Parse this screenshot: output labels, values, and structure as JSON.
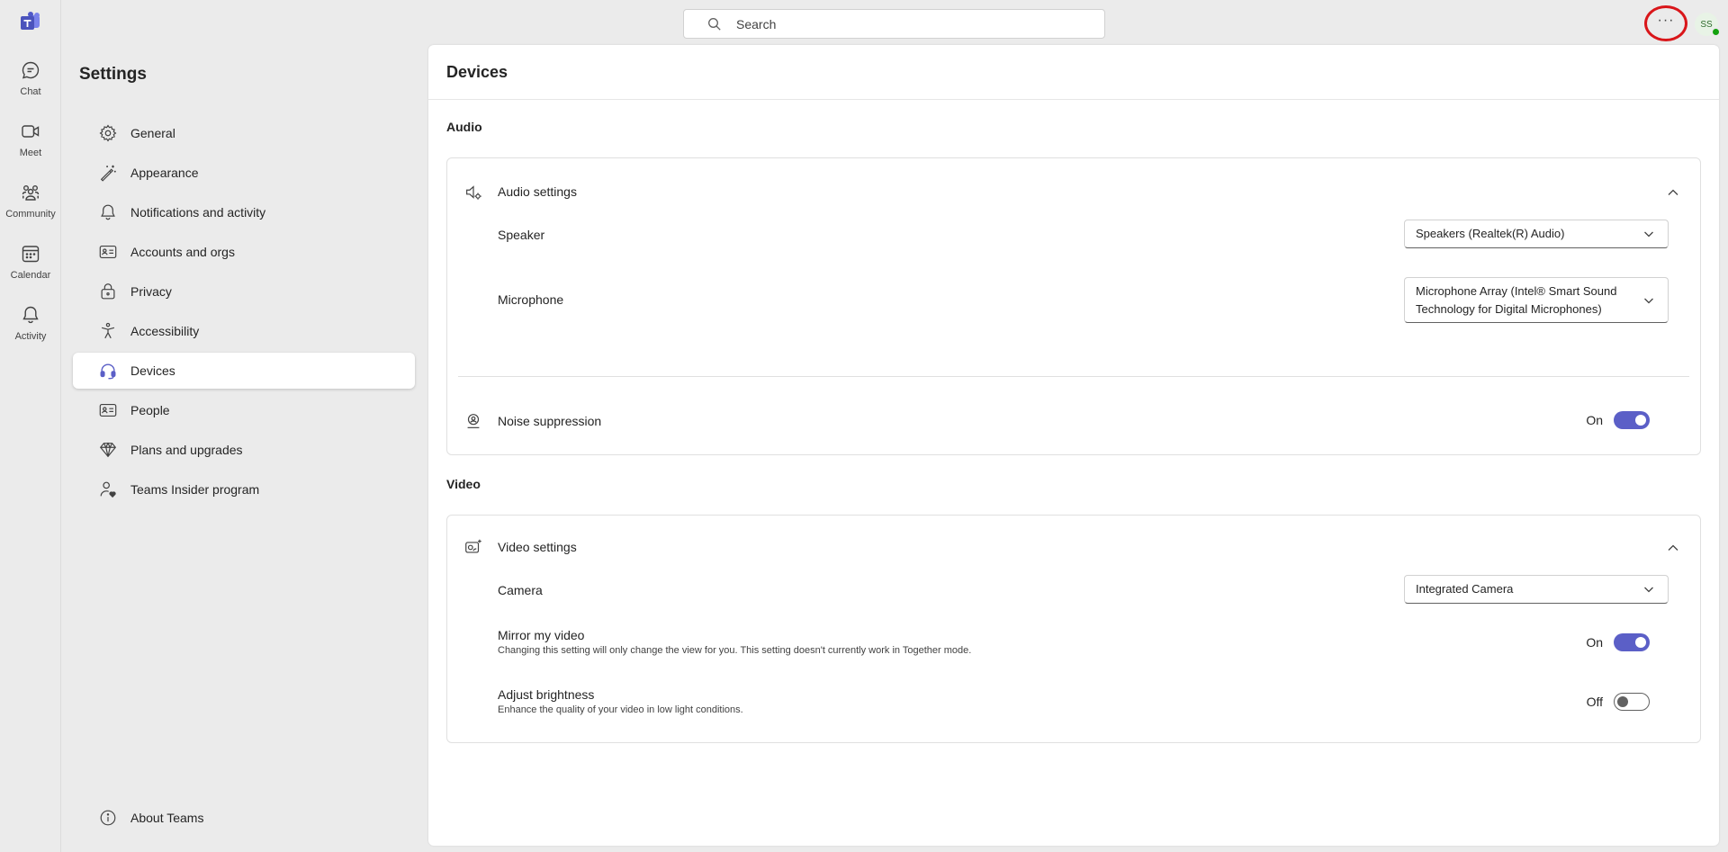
{
  "search": {
    "placeholder": "Search"
  },
  "topbar": {
    "more_label": "···",
    "avatar_initials": "SS"
  },
  "rail": {
    "items": [
      {
        "label": "Chat",
        "icon": "chat-icon"
      },
      {
        "label": "Meet",
        "icon": "video-icon"
      },
      {
        "label": "Community",
        "icon": "community-icon"
      },
      {
        "label": "Calendar",
        "icon": "calendar-icon"
      },
      {
        "label": "Activity",
        "icon": "bell-icon"
      }
    ]
  },
  "settings": {
    "title": "Settings",
    "nav": [
      {
        "label": "General",
        "icon": "gear-icon"
      },
      {
        "label": "Appearance",
        "icon": "magic-wand-icon"
      },
      {
        "label": "Notifications and activity",
        "icon": "bell-icon"
      },
      {
        "label": "Accounts and orgs",
        "icon": "id-card-icon"
      },
      {
        "label": "Privacy",
        "icon": "lock-icon"
      },
      {
        "label": "Accessibility",
        "icon": "accessibility-icon"
      },
      {
        "label": "Devices",
        "icon": "headset-icon",
        "active": true
      },
      {
        "label": "People",
        "icon": "contact-card-icon"
      },
      {
        "label": "Plans and upgrades",
        "icon": "diamond-icon"
      },
      {
        "label": "Teams Insider program",
        "icon": "person-heart-icon"
      }
    ],
    "about": "About Teams"
  },
  "devices": {
    "title": "Devices",
    "audio": {
      "section_title": "Audio",
      "card_title": "Audio settings",
      "speaker_label": "Speaker",
      "speaker_value": "Speakers (Realtek(R) Audio)",
      "microphone_label": "Microphone",
      "microphone_value_line1": "Microphone Array (Intel® Smart Sound",
      "microphone_value_line2": "Technology for Digital Microphones)",
      "noise_label": "Noise suppression",
      "noise_state": "On"
    },
    "video": {
      "section_title": "Video",
      "card_title": "Video settings",
      "camera_label": "Camera",
      "camera_value": "Integrated Camera",
      "mirror_label": "Mirror my video",
      "mirror_desc": "Changing this setting will only change the view for you. This setting doesn't currently work in Together mode.",
      "mirror_state": "On",
      "brightness_label": "Adjust brightness",
      "brightness_desc": "Enhance the quality of your video in low light conditions.",
      "brightness_state": "Off"
    }
  },
  "colors": {
    "accent": "#5b5fc7",
    "highlight_ring": "#d9161a",
    "presence": "#13a10e"
  }
}
